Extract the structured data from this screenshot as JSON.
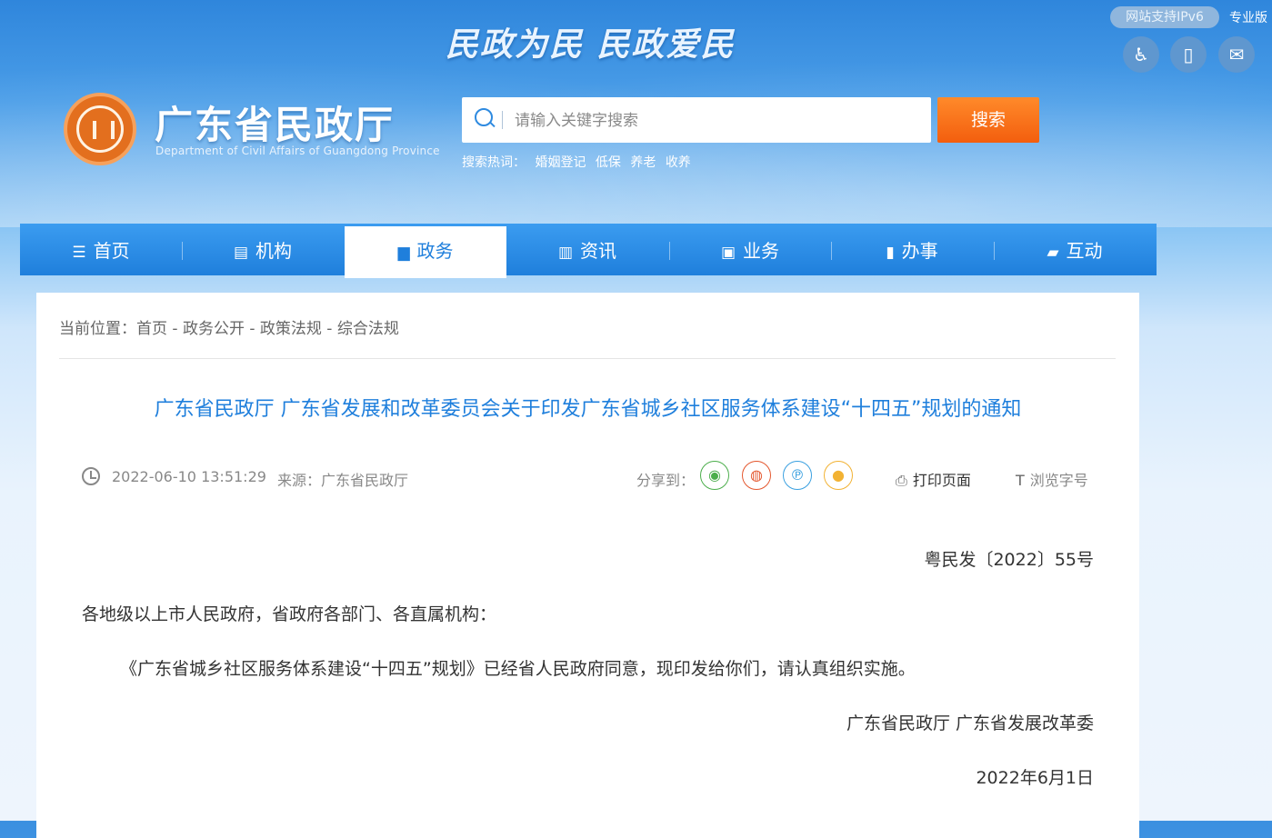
{
  "header": {
    "slogan": "民政为民  民政爱民",
    "ipv6": "网站支持IPv6",
    "pro_version": "专业版",
    "site_title": "广东省民政厅",
    "site_subtitle": "Department of Civil Affairs of Guangdong Province",
    "icons": [
      "accessibility-icon",
      "mobile-icon",
      "mail-icon"
    ]
  },
  "search": {
    "placeholder": "请输入关键字搜索",
    "button": "搜索",
    "hot_label": "搜索热词：",
    "hot_words": [
      "婚姻登记",
      "低保",
      "养老",
      "收养"
    ]
  },
  "nav": {
    "items": [
      {
        "label": "首页",
        "icon": "list-icon"
      },
      {
        "label": "机构",
        "icon": "document-icon"
      },
      {
        "label": "政务",
        "icon": "book-icon"
      },
      {
        "label": "资讯",
        "icon": "news-icon"
      },
      {
        "label": "业务",
        "icon": "briefcase-icon"
      },
      {
        "label": "办事",
        "icon": "clipboard-icon"
      },
      {
        "label": "互动",
        "icon": "chat-icon"
      }
    ],
    "active": "政务"
  },
  "breadcrumb": {
    "label": "当前位置：",
    "items": [
      "首页",
      "政务公开",
      "政策法规",
      "综合法规"
    ],
    "sep": " - "
  },
  "article": {
    "title": "广东省民政厅 广东省发展和改革委员会关于印发广东省城乡社区服务体系建设“十四五”规划的通知",
    "datetime": "2022-06-10 13:51:29",
    "source": "来源：广东省民政厅",
    "share_label": "分享到：",
    "share_icons": [
      "wechat-icon",
      "weibo-icon",
      "pinterest-icon",
      "qq-icon"
    ],
    "print_label": "打印页面",
    "font_label": "浏览字号",
    "doc_number": "粤民发〔2022〕55号",
    "salutation": "各地级以上市人民政府，省政府各部门、各直属机构：",
    "body": "《广东省城乡社区服务体系建设“十四五”规划》已经省人民政府同意，现印发给你们，请认真组织实施。",
    "signature": "广东省民政厅  广东省发展改革委",
    "date": "2022年6月1日"
  },
  "colors": {
    "nav_blue": "#1f7fdc",
    "search_orange": "#f35e0e",
    "title_blue": "#1f7fdc",
    "logo_orange": "#e36f1e"
  }
}
